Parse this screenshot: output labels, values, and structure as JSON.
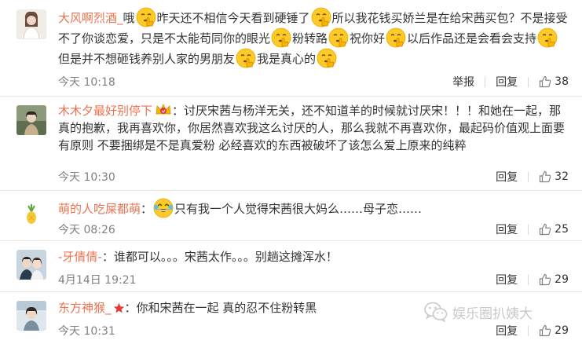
{
  "comments": [
    {
      "username": "大风啊烈酒_",
      "text_parts": [
        "哦",
        "昨天还不相信今天看到硬锤了",
        "所以我花钱买娇兰是在给宋茜买包？不是接受不了你谈恋爱，只是不太能苟同你的眼光",
        "粉转路",
        "祝你好",
        "以后作品还是会看会支持",
        "但是并不想砸钱养别人家的男朋友",
        "我是真心的",
        ""
      ],
      "time": "今天 10:18",
      "report": "举报",
      "reply": "回复",
      "likes": "38"
    },
    {
      "username": "木木夕最好别停下",
      "text": "：讨厌宋茜与杨洋无关，还不知道羊的时候就讨厌宋！！！和她在一起，那真的抱歉，我再喜欢你，你居然喜欢我这么讨厌的人，那么我就不再喜欢你，最起码价值观上面要有原则  不要捆绑是不是真爱粉  必经喜欢的东西被破坏了该怎么爱上原来的纯粹",
      "time": "今天 10:30",
      "reply": "回复",
      "likes": "32"
    },
    {
      "username": "萌的人吃屎都萌",
      "text_before": "：",
      "text_after": "只有我一个人觉得宋茜很大妈么……母子恋……",
      "time": "今天 08:26",
      "reply": "回复",
      "likes": "25"
    },
    {
      "username": "-牙倩倩-",
      "text": "：谁都可以。。。宋茜太作。。。别趟这摊浑水！",
      "time": "4月14日 19:21",
      "reply": "回复",
      "likes": "29"
    },
    {
      "username": "东方神猴_",
      "text": "：你和宋茜在一起 真的忍不住粉转黑",
      "time": "今天 10:31",
      "reply": "回复",
      "likes": "29"
    }
  ],
  "watermark": "娱乐圈扒姨大",
  "icons": {
    "emoji": "shush-emoji-icon",
    "laugh": "laughing-tears-emoji-icon",
    "crown": "crown-badge-icon",
    "star": "red-star-icon",
    "like": "thumbs-up-icon",
    "wechat": "wechat-logo-icon"
  },
  "colors": {
    "username": "#eb7350",
    "meta": "#808080",
    "divider": "#e6e6e6",
    "watermark": "#c9c9c9"
  }
}
